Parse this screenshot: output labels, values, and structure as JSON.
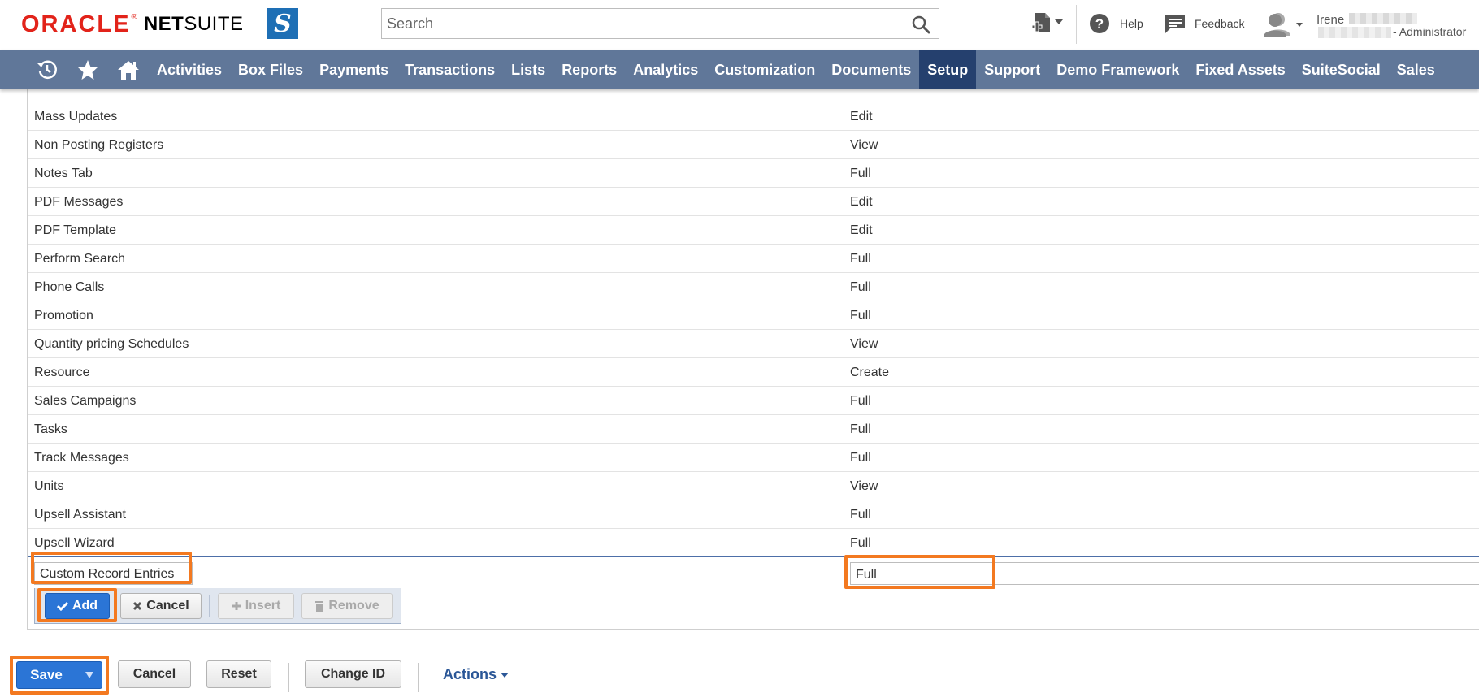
{
  "header": {
    "logo_oracle": "ORACLE",
    "logo_reg": "®",
    "logo_net": "NET",
    "logo_suite": "SUITE",
    "badge": "S",
    "search_placeholder": "Search",
    "help_label": "Help",
    "feedback_label": "Feedback",
    "user_first_name": "Irene",
    "user_role": "- Administrator"
  },
  "nav": {
    "items": [
      "Activities",
      "Box Files",
      "Payments",
      "Transactions",
      "Lists",
      "Reports",
      "Analytics",
      "Customization",
      "Documents",
      "Setup",
      "Support",
      "Demo Framework",
      "Fixed Assets",
      "SuiteSocial",
      "Sales"
    ],
    "active": "Setup"
  },
  "permissions": {
    "rows": [
      {
        "permission": "Mass Updates",
        "level": "Edit"
      },
      {
        "permission": "Non Posting Registers",
        "level": "View"
      },
      {
        "permission": "Notes Tab",
        "level": "Full"
      },
      {
        "permission": "PDF Messages",
        "level": "Edit"
      },
      {
        "permission": "PDF Template",
        "level": "Edit"
      },
      {
        "permission": "Perform Search",
        "level": "Full"
      },
      {
        "permission": "Phone Calls",
        "level": "Full"
      },
      {
        "permission": "Promotion",
        "level": "Full"
      },
      {
        "permission": "Quantity pricing Schedules",
        "level": "View"
      },
      {
        "permission": "Resource",
        "level": "Create"
      },
      {
        "permission": "Sales Campaigns",
        "level": "Full"
      },
      {
        "permission": "Tasks",
        "level": "Full"
      },
      {
        "permission": "Track Messages",
        "level": "Full"
      },
      {
        "permission": "Units",
        "level": "View"
      },
      {
        "permission": "Upsell Assistant",
        "level": "Full"
      },
      {
        "permission": "Upsell Wizard",
        "level": "Full"
      }
    ],
    "edit_row": {
      "permission": "Custom Record Entries",
      "level": "Full"
    },
    "buttons": {
      "add": "Add",
      "cancel": "Cancel",
      "insert": "Insert",
      "remove": "Remove"
    }
  },
  "footer": {
    "save": "Save",
    "cancel": "Cancel",
    "reset": "Reset",
    "change_id": "Change ID",
    "actions": "Actions"
  },
  "colors": {
    "nav_bg": "#607799",
    "nav_active": "#25406e",
    "primary": "#2b75d6",
    "highlight": "#f37920"
  }
}
